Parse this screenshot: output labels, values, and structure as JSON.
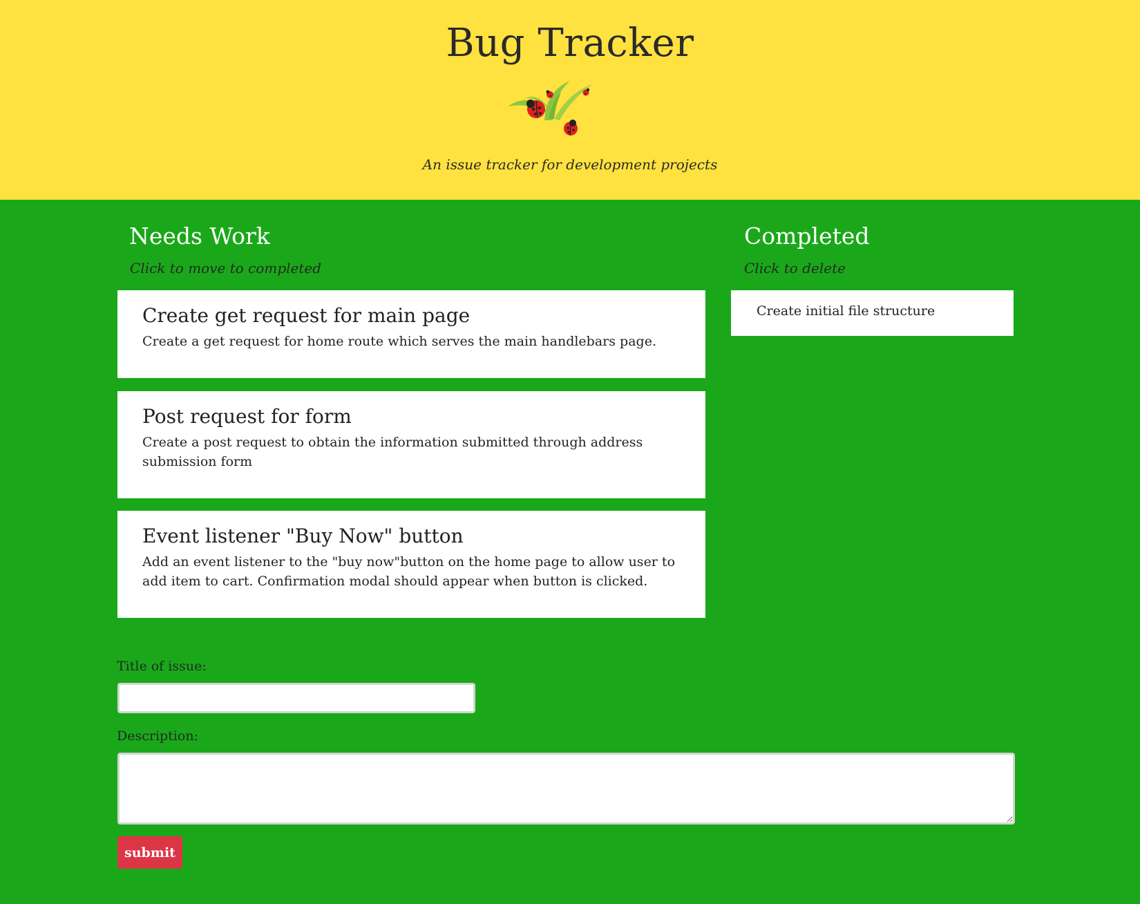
{
  "header": {
    "title": "Bug Tracker",
    "tagline": "An issue tracker for development projects",
    "logo_icon": "ladybugs-on-grass-icon"
  },
  "needs_work": {
    "heading": "Needs Work",
    "hint": "Click to move to completed",
    "items": [
      {
        "title": "Create get request for main page",
        "description": "Create a get request for home route which serves the main handlebars page."
      },
      {
        "title": "Post request for form",
        "description": "Create a post request to obtain the information submitted through address submission form"
      },
      {
        "title": "Event listener \"Buy Now\" button",
        "description": "Add an event listener to the \"buy now\"button on the home page to allow user to add item to cart. Confirmation modal should appear when button is clicked."
      }
    ]
  },
  "completed": {
    "heading": "Completed",
    "hint": "Click to delete",
    "items": [
      {
        "title": "Create initial file structure"
      }
    ]
  },
  "form": {
    "title_label": "Title of issue:",
    "title_value": "",
    "description_label": "Description:",
    "description_value": "",
    "submit_label": "submit"
  },
  "colors": {
    "header_bg": "#ffe23f",
    "page_bg": "#1aa81a",
    "submit_bg": "#dc3545"
  }
}
